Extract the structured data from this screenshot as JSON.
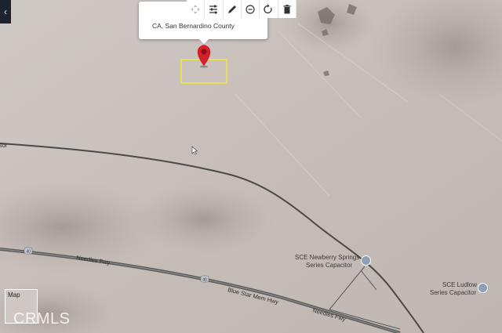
{
  "popup": {
    "location": "CA, San Bernardino County"
  },
  "toolbar": {
    "tools": [
      {
        "icon": "move-icon"
      },
      {
        "icon": "sliders-icon"
      },
      {
        "icon": "pencil-icon"
      },
      {
        "icon": "clock-icon"
      },
      {
        "icon": "rotate-icon"
      },
      {
        "icon": "trash-icon"
      }
    ]
  },
  "map": {
    "road_labels": {
      "left_edge": "tor",
      "needles_fwy_west": "Needles Fwy",
      "blue_star": "Blue Star Mem Hwy",
      "needles_fwy_east": "Needles Fwy",
      "interstate_shield_1": "40",
      "interstate_shield_2": "40"
    },
    "poi": [
      {
        "line1": "SCE Newberry Springs",
        "line2": "Series Capacitor"
      },
      {
        "line1": "SCE Ludlow",
        "line2": "Series Capacitor"
      }
    ],
    "thumbnail_label": "Map",
    "watermark": "CRMLS"
  },
  "colors": {
    "terrain": "#c9c1bd",
    "highway": "#4a4a4a",
    "pin": "#d2212a",
    "selection": "#f2e836"
  }
}
